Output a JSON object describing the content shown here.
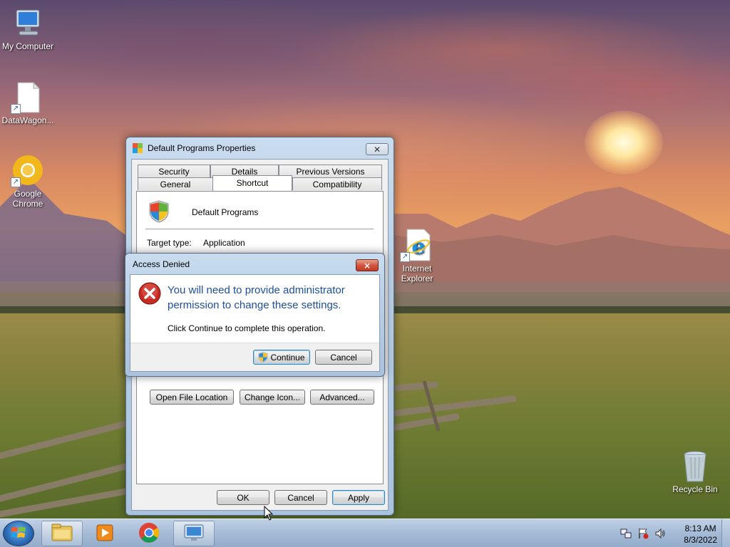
{
  "desktop": {
    "icons": [
      {
        "label": "My Computer"
      },
      {
        "label": "DataWagon..."
      },
      {
        "label": "Google Chrome"
      },
      {
        "label": "Internet Explorer"
      },
      {
        "label": "Recycle Bin"
      }
    ]
  },
  "properties_dialog": {
    "title": "Default Programs Properties",
    "tabs_row1": [
      "Security",
      "Details",
      "Previous Versions"
    ],
    "tabs_row2": [
      "General",
      "Shortcut",
      "Compatibility"
    ],
    "active_tab": "Shortcut",
    "app_name": "Default Programs",
    "target_type_label": "Target type:",
    "target_type_value": "Application",
    "buttons": {
      "open_file_location": "Open File Location",
      "change_icon": "Change Icon...",
      "advanced": "Advanced...",
      "ok": "OK",
      "cancel": "Cancel",
      "apply": "Apply"
    }
  },
  "access_denied_dialog": {
    "title": "Access Denied",
    "close_label": "×",
    "main_instruction": "You will need to provide administrator permission to change these settings.",
    "content": "Click Continue to complete this operation.",
    "continue_label": "Continue",
    "cancel_label": "Cancel"
  },
  "taskbar": {
    "pinned": [
      "windows-explorer-icon",
      "media-player-icon",
      "chrome-icon",
      "control-panel-icon"
    ],
    "clock_time": "8:13 AM",
    "clock_date": "8/3/2022"
  }
}
